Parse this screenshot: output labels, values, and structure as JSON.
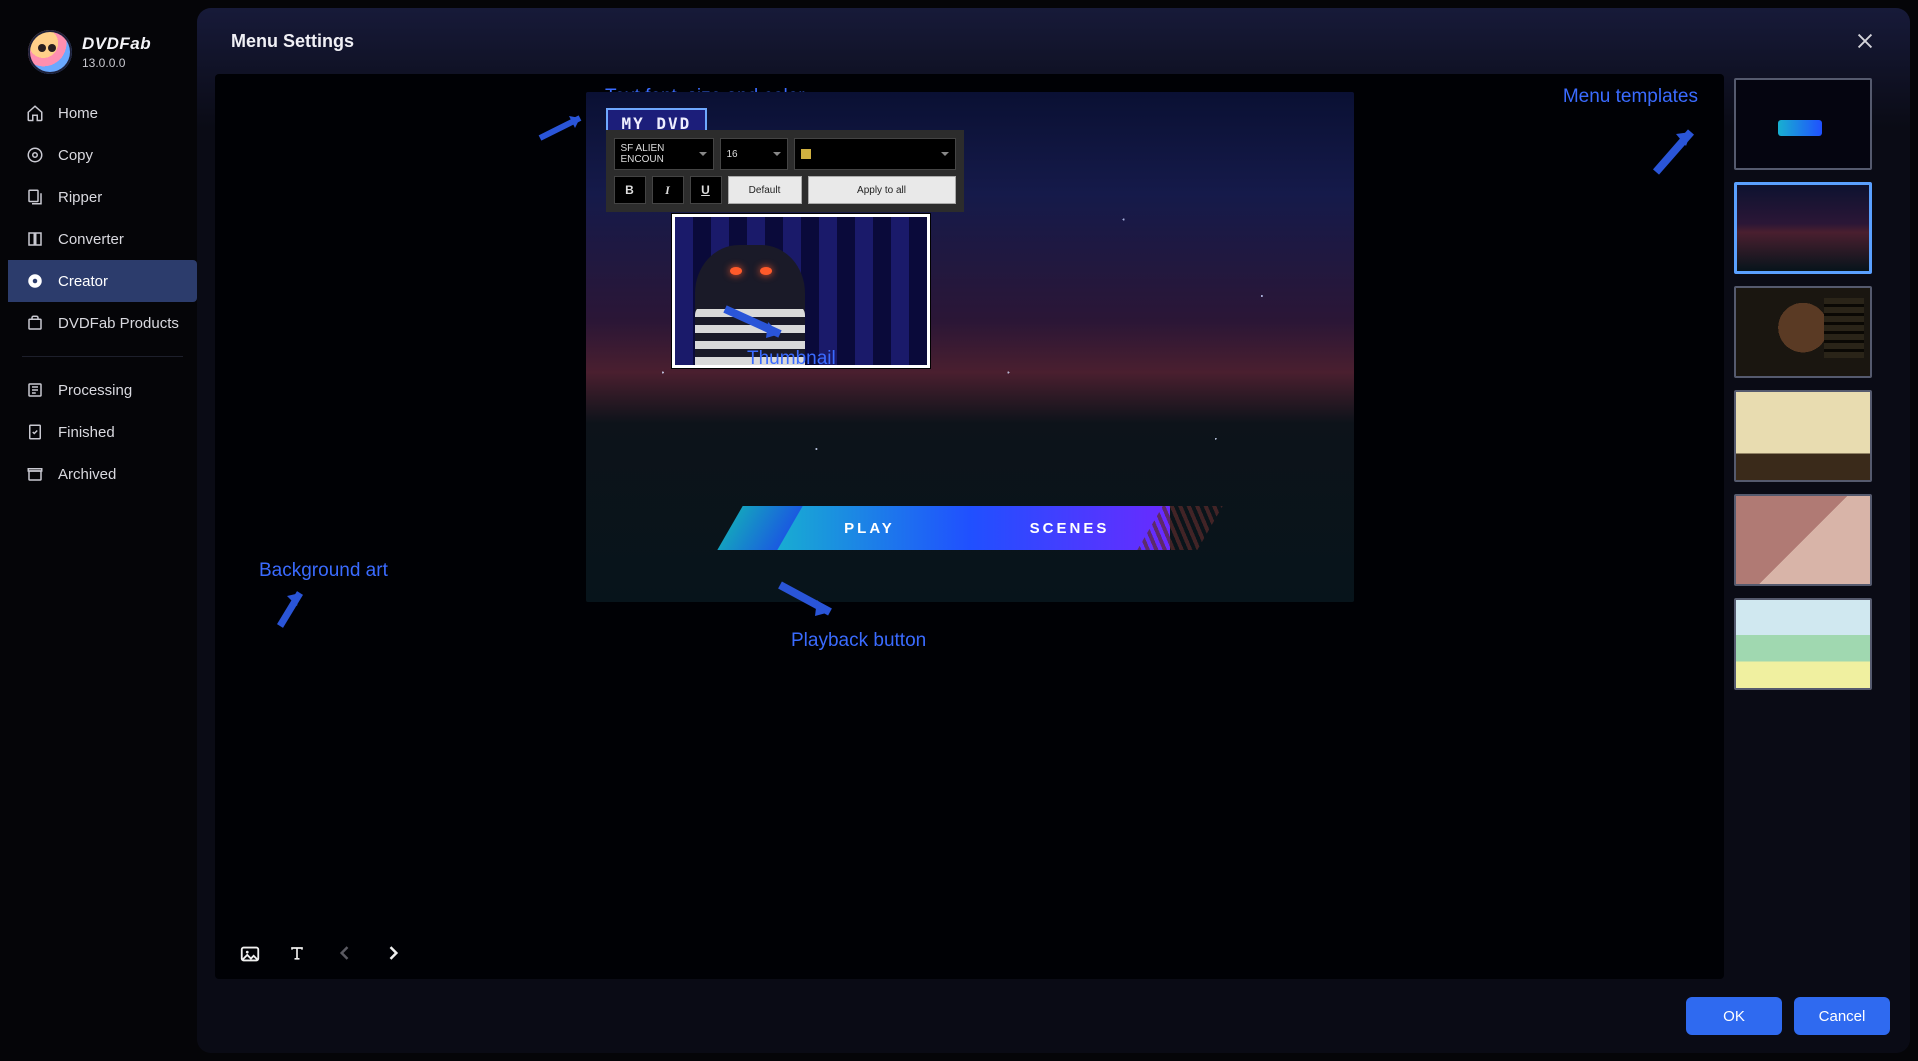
{
  "brand": {
    "name": "DVDFab",
    "version": "13.0.0.0"
  },
  "sidebar": {
    "items": [
      {
        "label": "Home",
        "icon": "home-icon"
      },
      {
        "label": "Copy",
        "icon": "copy-icon"
      },
      {
        "label": "Ripper",
        "icon": "ripper-icon"
      },
      {
        "label": "Converter",
        "icon": "converter-icon"
      },
      {
        "label": "Creator",
        "icon": "creator-icon",
        "active": true
      },
      {
        "label": "DVDFab Products",
        "icon": "products-icon"
      }
    ],
    "secondary": [
      {
        "label": "Processing",
        "icon": "processing-icon"
      },
      {
        "label": "Finished",
        "icon": "finished-icon"
      },
      {
        "label": "Archived",
        "icon": "archived-icon"
      }
    ]
  },
  "modal": {
    "title": "Menu Settings",
    "ok": "OK",
    "cancel": "Cancel"
  },
  "preview": {
    "title_text": "MY DVD",
    "font_name": "SF ALIEN ENCOUN",
    "font_size": "16",
    "color_hex": "#d0b040",
    "default_btn": "Default",
    "apply_btn": "Apply to all",
    "play_label": "PLAY",
    "scenes_label": "SCENES"
  },
  "annotations": {
    "text_tool": "Text font, size and color",
    "thumbnail": "Thumbnail",
    "menu_templates": "Menu templates",
    "background": "Background art",
    "playback": "Playback button"
  },
  "templates": {
    "selected_index": 1,
    "count": 6
  }
}
